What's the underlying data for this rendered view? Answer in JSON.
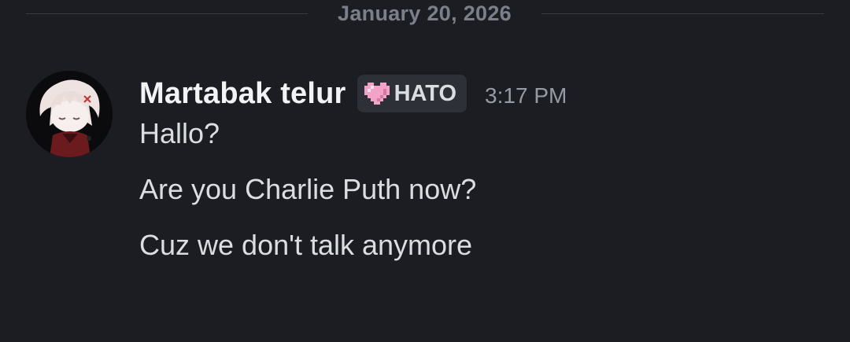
{
  "divider": {
    "date": "January 20, 2026"
  },
  "message": {
    "author": "Martabak telur",
    "tag": {
      "icon": "pixel-heart-icon",
      "label": "HATO",
      "icon_color": "#f3a3c7"
    },
    "timestamp": "3:17 PM",
    "lines": [
      "Hallo?",
      "Are you Charlie Puth now?",
      "Cuz we don't talk anymore"
    ]
  },
  "colors": {
    "background": "#1c1d22",
    "username": "#f2f3f5",
    "text": "#dbdee1",
    "muted": "#949ba4",
    "badge_bg": "#2e3038"
  }
}
